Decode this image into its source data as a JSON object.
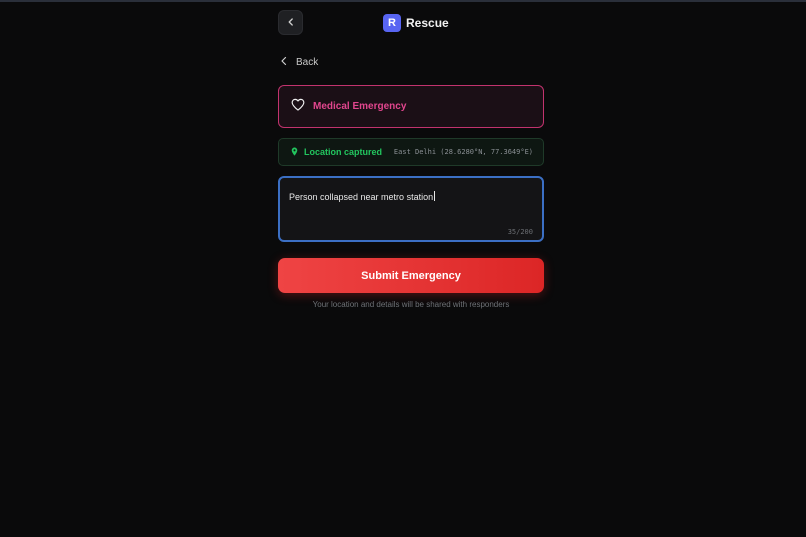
{
  "header": {
    "brand_initial": "R",
    "brand_name": "Rescue"
  },
  "nav": {
    "back_label": "Back"
  },
  "emergency": {
    "type_label": "Medical Emergency",
    "icon": "heart-icon"
  },
  "location": {
    "status": "Location captured",
    "coords": "East Delhi (28.6280°N, 77.3649°E)",
    "icon": "location-pin-icon"
  },
  "description": {
    "value": "Person collapsed near metro station",
    "char_count": "35/200"
  },
  "actions": {
    "submit_label": "Submit Emergency",
    "note": "Your location and details will be shared with responders"
  },
  "colors": {
    "accent_red": "#ef4444",
    "medical_pink": "#e2468e",
    "location_green": "#22c55e",
    "focus_blue": "#3b6fc4",
    "brand_blue": "#5865f2"
  }
}
